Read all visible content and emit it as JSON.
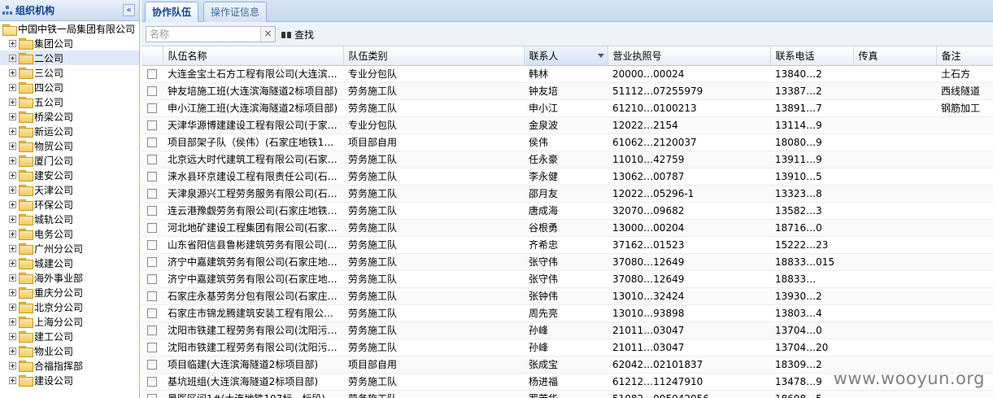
{
  "left_panel": {
    "title": "组织机构",
    "collapse_glyph": "«",
    "root": "中国中铁一局集团有限公司",
    "items": [
      {
        "label": "集团公司",
        "selected": false
      },
      {
        "label": "二公司",
        "selected": true
      },
      {
        "label": "三公司",
        "selected": false
      },
      {
        "label": "四公司",
        "selected": false
      },
      {
        "label": "五公司",
        "selected": false
      },
      {
        "label": "桥梁公司",
        "selected": false
      },
      {
        "label": "新运公司",
        "selected": false
      },
      {
        "label": "物贸公司",
        "selected": false
      },
      {
        "label": "厦门公司",
        "selected": false
      },
      {
        "label": "建安公司",
        "selected": false
      },
      {
        "label": "天津公司",
        "selected": false
      },
      {
        "label": "环保公司",
        "selected": false
      },
      {
        "label": "城轨公司",
        "selected": false
      },
      {
        "label": "电务公司",
        "selected": false
      },
      {
        "label": "广州分公司",
        "selected": false
      },
      {
        "label": "城建公司",
        "selected": false
      },
      {
        "label": "海外事业部",
        "selected": false
      },
      {
        "label": "重庆分公司",
        "selected": false
      },
      {
        "label": "北京分公司",
        "selected": false
      },
      {
        "label": "上海分公司",
        "selected": false
      },
      {
        "label": "建工公司",
        "selected": false
      },
      {
        "label": "物业公司",
        "selected": false
      },
      {
        "label": "合福指挥部",
        "selected": false
      },
      {
        "label": "建设公司",
        "selected": false
      }
    ]
  },
  "tabs": [
    {
      "label": "协作队伍",
      "active": true
    },
    {
      "label": "操作证信息",
      "active": false
    }
  ],
  "toolbar": {
    "search_placeholder": "名称",
    "search_value": "",
    "clear_glyph": "×",
    "find_label": "查找"
  },
  "grid": {
    "columns": [
      "队伍名称",
      "队伍类别",
      "联系人",
      "营业执照号",
      "联系电话",
      "传真",
      "备注"
    ],
    "sorted_column": "联系人",
    "rows": [
      [
        "大连金宝土石方工程有限公司(大连滨…",
        "专业分包队",
        "韩林",
        "20000…00024",
        "13840…2",
        "",
        "土石方"
      ],
      [
        "钟友培施工班(大连滨海隧道2标项目部)",
        "劳务施工队",
        "钟友培",
        "51112…07255979",
        "13387…2",
        "",
        "西线隧道"
      ],
      [
        "申小江施工班(大连滨海隧道2标项目部)",
        "劳务施工队",
        "申小江",
        "61210…0100213",
        "13891…7",
        "",
        "钢筋加工"
      ],
      [
        "天津华源博建建设工程有限公司(于家…",
        "专业分包队",
        "金泉波",
        "12022…2154",
        "13114…9",
        "",
        ""
      ],
      [
        "项目部架子队（侯伟）(石家庄地铁1…",
        "项目部自用",
        "侯伟",
        "61062…2120037",
        "18080…9",
        "",
        ""
      ],
      [
        "北京远大时代建筑工程有限公司(石家…",
        "劳务施工队",
        "任永豪",
        "11010…42759",
        "13911…9",
        "",
        ""
      ],
      [
        "涞水县环京建设工程有限责任公司(石…",
        "劳务施工队",
        "李永健",
        "13062…00787",
        "13910…5",
        "",
        ""
      ],
      [
        "天津泉源兴工程劳务服务有限公司(石…",
        "劳务施工队",
        "邵月友",
        "12022…05296-1",
        "13323…8",
        "",
        ""
      ],
      [
        "连云港豫觑劳务有限公司(石家庄地铁…",
        "劳务施工队",
        "唐成海",
        "32070…09682",
        "13582…3",
        "",
        ""
      ],
      [
        "河北地矿建设工程集团有限公司(石家…",
        "劳务施工队",
        "谷根勇",
        "13000…00204",
        "18716…0",
        "",
        ""
      ],
      [
        "山东省阳信县鲁彬建筑劳务有限公司(…",
        "劳务施工队",
        "齐希忠",
        "37162…01523",
        "15222…23",
        "",
        ""
      ],
      [
        "济宁中嘉建筑劳务有限公司(石家庄地…",
        "劳务施工队",
        "张守伟",
        "37080…12649",
        "18833…015",
        "",
        ""
      ],
      [
        "济宁中嘉建筑劳务有限公司(石家庄地…",
        "劳务施工队",
        "张守伟",
        "37080…12649",
        "18833…",
        "",
        ""
      ],
      [
        "石家庄永基劳务分包有限公司(石家庄…",
        "劳务施工队",
        "张钟伟",
        "13010…32424",
        "13930…2",
        "",
        ""
      ],
      [
        "石家庄市锦龙腾建筑安装工程有限公…",
        "劳务施工队",
        "周先亮",
        "13010…93898",
        "13803…4",
        "",
        ""
      ],
      [
        "沈阳市铁建工程劳务有限公司(沈阳污…",
        "劳务施工队",
        "孙峰",
        "21011…03047",
        "13704…0",
        "",
        ""
      ],
      [
        "沈阳市铁建工程劳务有限公司(沈阳污…",
        "劳务施工队",
        "孙峰",
        "21011…03047",
        "13704…20",
        "",
        ""
      ],
      [
        "项目临建(大连滨海隧道2标项目部)",
        "项目部自用",
        "张成宝",
        "62042…02101837",
        "18309…2",
        "",
        ""
      ],
      [
        "基坑班组(大连滨海隧道2标项目部)",
        "劳务施工队",
        "杨进福",
        "61212…11247910",
        "13478…9",
        "",
        ""
      ],
      [
        "暑医区间1#(大连地铁107标…标段)",
        "劳务施工队",
        "罗芳华",
        "51082…005042056",
        "18698…5",
        "",
        ""
      ]
    ]
  },
  "watermark": "www.wooyun.org",
  "colors": {
    "header_bg": "#dfe8f6",
    "border": "#99bbe8",
    "tab_text": "#15428b",
    "selected_row": "#dfe8f6"
  }
}
